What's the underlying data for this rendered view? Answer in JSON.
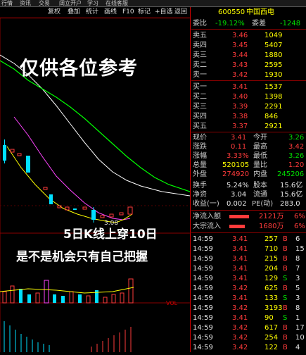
{
  "topmenu": [
    "行情",
    "资讯",
    "交易",
    "阔立开户",
    "学习",
    "在线客服"
  ],
  "toolbar": {
    "items": [
      "复权",
      "叠加",
      "统计",
      "画线",
      "F10",
      "标记",
      "+自选",
      "返回"
    ]
  },
  "stock": {
    "code": "600550",
    "name": "中国西电"
  },
  "ratio": {
    "label": "委比",
    "value": "-19.12%",
    "diff_label": "委差",
    "diff": "-1248"
  },
  "asks": [
    {
      "label": "卖五",
      "price": "3.46",
      "vol": "1049"
    },
    {
      "label": "卖四",
      "price": "3.45",
      "vol": "5407"
    },
    {
      "label": "卖三",
      "price": "3.44",
      "vol": "1880"
    },
    {
      "label": "卖二",
      "price": "3.43",
      "vol": "2595"
    },
    {
      "label": "卖一",
      "price": "3.42",
      "vol": "1930"
    }
  ],
  "bids": [
    {
      "label": "买一",
      "price": "3.41",
      "vol": "1537"
    },
    {
      "label": "买二",
      "price": "3.40",
      "vol": "1398"
    },
    {
      "label": "买三",
      "price": "3.39",
      "vol": "2291"
    },
    {
      "label": "买四",
      "price": "3.38",
      "vol": "846"
    },
    {
      "label": "买五",
      "price": "3.37",
      "vol": "2921"
    }
  ],
  "quote": [
    {
      "l1": "现价",
      "v1": "3.41",
      "c1": "red",
      "l2": "今开",
      "v2": "3.26",
      "c2": "grn"
    },
    {
      "l1": "涨跌",
      "v1": "0.11",
      "c1": "red",
      "l2": "最高",
      "v2": "3.42",
      "c2": "red"
    },
    {
      "l1": "涨幅",
      "v1": "3.33%",
      "c1": "red",
      "l2": "最低",
      "v2": "3.26",
      "c2": "grn"
    },
    {
      "l1": "总量",
      "v1": "520105",
      "c1": "yel",
      "l2": "量比",
      "v2": "1.20",
      "c2": "red"
    },
    {
      "l1": "外盘",
      "v1": "274920",
      "c1": "red",
      "l2": "内盘",
      "v2": "245206",
      "c2": "grn"
    },
    {
      "l1": "换手",
      "v1": "5.24%",
      "c1": "wht",
      "l2": "股本",
      "v2": "15.6亿",
      "c2": "wht"
    },
    {
      "l1": "净资",
      "v1": "3.04",
      "c1": "wht",
      "l2": "流通",
      "v2": "15.6亿",
      "c2": "wht"
    },
    {
      "l1": "收益(一)",
      "v1": "0.002",
      "c1": "wht",
      "l2": "PE(动)",
      "v2": "283.0",
      "c2": "wht"
    }
  ],
  "flows": [
    {
      "label": "净流入额",
      "value": "2121万",
      "pct": "6%"
    },
    {
      "label": "大宗流入",
      "value": "1680万",
      "pct": "6%"
    }
  ],
  "ticks": [
    {
      "time": "14:59",
      "price": "3.41",
      "vol": "257",
      "dir": "B",
      "n": "6",
      "pc": "red",
      "dc": "red"
    },
    {
      "time": "14:59",
      "price": "3.41",
      "vol": "710",
      "dir": "B",
      "n": "15",
      "pc": "red",
      "dc": "red"
    },
    {
      "time": "14:59",
      "price": "3.41",
      "vol": "215",
      "dir": "B",
      "n": "8",
      "pc": "red",
      "dc": "red"
    },
    {
      "time": "14:59",
      "price": "3.41",
      "vol": "204",
      "dir": "B",
      "n": "7",
      "pc": "red",
      "dc": "red"
    },
    {
      "time": "14:59",
      "price": "3.41",
      "vol": "129",
      "dir": "S",
      "n": "3",
      "pc": "red",
      "dc": "grn"
    },
    {
      "time": "14:59",
      "price": "3.42",
      "vol": "625",
      "dir": "B",
      "n": "5",
      "pc": "red",
      "dc": "red"
    },
    {
      "time": "14:59",
      "price": "3.41",
      "vol": "133",
      "dir": "S",
      "n": "3",
      "pc": "red",
      "dc": "grn"
    },
    {
      "time": "14:59",
      "price": "3.42",
      "vol": "3193",
      "dir": "B",
      "n": "8",
      "pc": "red",
      "dc": "red"
    },
    {
      "time": "14:59",
      "price": "3.41",
      "vol": "90",
      "dir": "S",
      "n": "1",
      "pc": "red",
      "dc": "grn"
    },
    {
      "time": "14:59",
      "price": "3.42",
      "vol": "617",
      "dir": "B",
      "n": "17",
      "pc": "red",
      "dc": "red"
    },
    {
      "time": "14:59",
      "price": "3.42",
      "vol": "254",
      "dir": "B",
      "n": "10",
      "pc": "red",
      "dc": "red"
    },
    {
      "time": "14:59",
      "price": "3.42",
      "vol": "122",
      "dir": "B",
      "n": "4",
      "pc": "red",
      "dc": "red"
    }
  ],
  "chart": {
    "low_label": "3.08",
    "volume_label": "VOL",
    "overlay_title": "仅供各位参考",
    "overlay_line1": "5日K线上穿10日",
    "overlay_line2": "是不是机会只有自己把握"
  },
  "colors": {
    "up": "#ff3b3b",
    "down": "#00e0ff",
    "ma5": "#ffff00",
    "ma10": "#ff44ff",
    "ma20": "#00ff00",
    "ma30": "#ffffff",
    "accent": "#cc0000"
  }
}
